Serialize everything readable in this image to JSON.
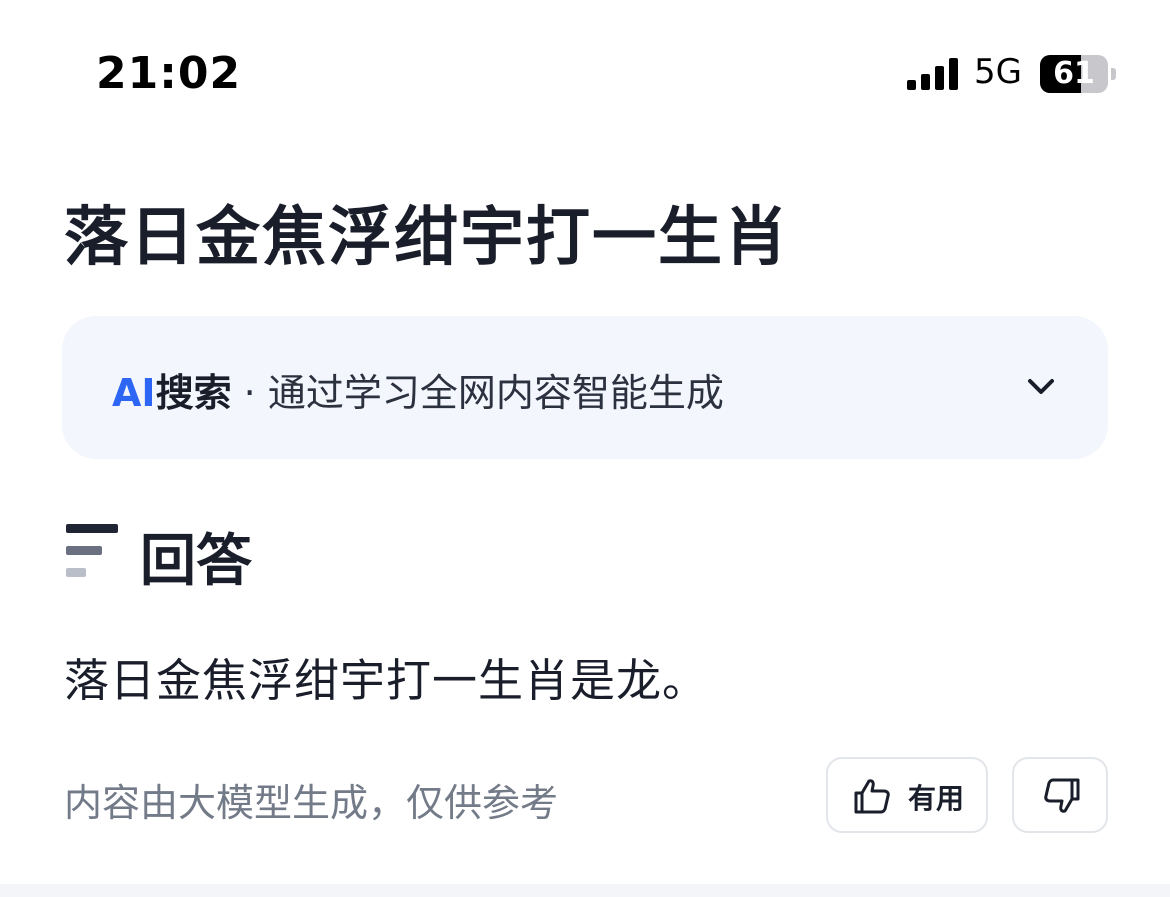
{
  "status_bar": {
    "time": "21:02",
    "network": "5G",
    "battery_level": "61",
    "signal_bars": 4
  },
  "page": {
    "title": "落日金焦浮绀宇打一生肖"
  },
  "ai_search": {
    "brand": "AI",
    "label": "搜索",
    "separator": " · ",
    "description": "通过学习全网内容智能生成",
    "accent_color": "#2d66f5",
    "expand_icon": "chevron-down-icon"
  },
  "answer": {
    "heading": "回答",
    "text": "落日金焦浮绀宇打一生肖是龙。"
  },
  "footer": {
    "disclaimer": "内容由大模型生成，仅供参考",
    "useful_label": "有用",
    "useful_icon": "thumbs-up-icon",
    "dislike_icon": "thumbs-down-icon"
  }
}
